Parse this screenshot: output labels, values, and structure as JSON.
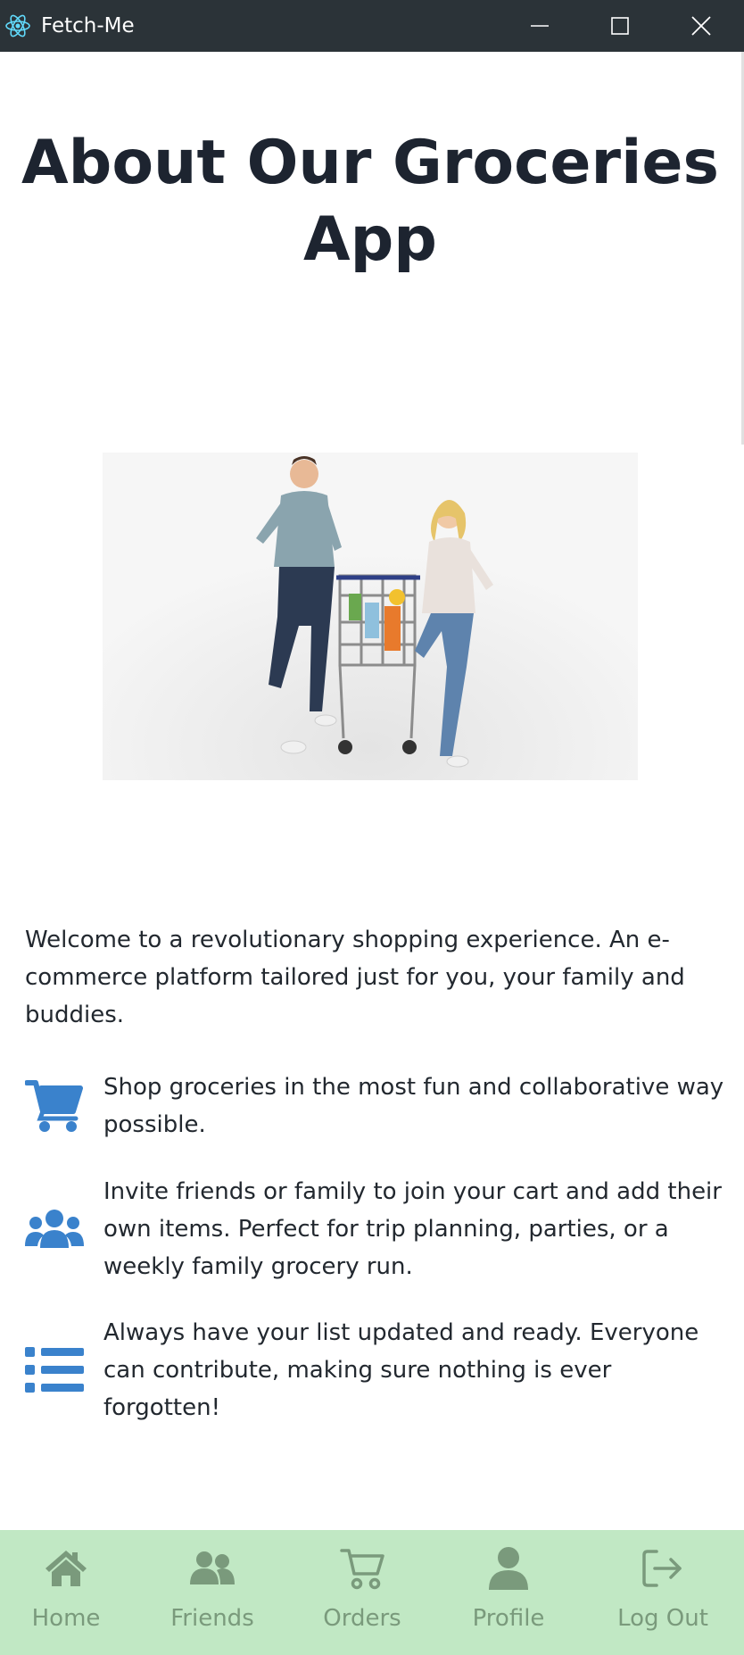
{
  "window": {
    "title": "Fetch-Me",
    "icon": "react-atom-icon",
    "controls": [
      "minimize-icon",
      "maximize-icon",
      "close-icon"
    ]
  },
  "main": {
    "heading": "About Our Groceries App",
    "intro": "Welcome to a revolutionary shopping experience. An e-commerce platform tailored just for you, your family and buddies.",
    "features": [
      {
        "icon": "shopping-cart-icon",
        "text": "Shop groceries in the most fun and collaborative way possible."
      },
      {
        "icon": "users-icon",
        "text": "Invite friends or family to join your cart and add their own items. Perfect for trip planning, parties, or a weekly family grocery run."
      },
      {
        "icon": "list-icon",
        "text": "Always have your list updated and ready. Everyone can contribute, making sure nothing is ever forgotten!"
      }
    ]
  },
  "nav": {
    "items": [
      {
        "label": "Home",
        "icon": "home-icon"
      },
      {
        "label": "Friends",
        "icon": "users-icon"
      },
      {
        "label": "Orders",
        "icon": "cart-outline-icon"
      },
      {
        "label": "Profile",
        "icon": "user-icon"
      },
      {
        "label": "Log Out",
        "icon": "logout-icon"
      }
    ]
  },
  "colors": {
    "titlebar": "#2b3338",
    "heading": "#1d2430",
    "feature_icon": "#3a82cc",
    "nav_background": "#c1e8c4",
    "nav_item": "#7a9a7c"
  }
}
